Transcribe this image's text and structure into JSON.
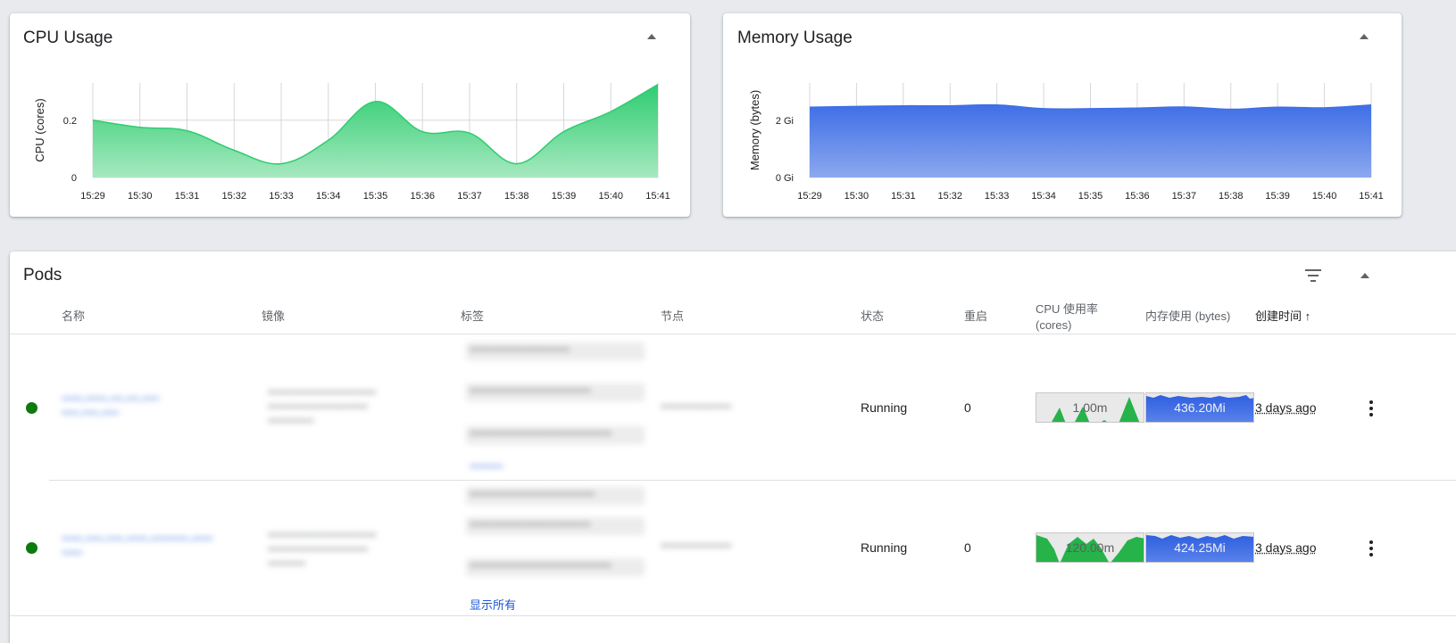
{
  "cpu_panel": {
    "title": "CPU Usage",
    "chart_data": {
      "type": "area",
      "title": "",
      "xlabel": "",
      "ylabel": "CPU (cores)",
      "x": [
        "15:29",
        "15:30",
        "15:31",
        "15:32",
        "15:33",
        "15:34",
        "15:35",
        "15:36",
        "15:37",
        "15:38",
        "15:39",
        "15:40",
        "15:41"
      ],
      "y_ticks": [
        "0",
        "0.2"
      ],
      "ylim": [
        0,
        0.33
      ],
      "series": [
        {
          "values": [
            0.2,
            0.175,
            0.163,
            0.095,
            0.048,
            0.13,
            0.265,
            0.16,
            0.155,
            0.048,
            0.16,
            0.23,
            0.325
          ],
          "color": "#2ecc71"
        }
      ],
      "grid": true
    }
  },
  "memory_panel": {
    "title": "Memory Usage",
    "chart_data": {
      "type": "area",
      "title": "",
      "xlabel": "",
      "ylabel": "Memory (bytes)",
      "x": [
        "15:29",
        "15:30",
        "15:31",
        "15:32",
        "15:33",
        "15:34",
        "15:35",
        "15:36",
        "15:37",
        "15:38",
        "15:39",
        "15:40",
        "15:41"
      ],
      "y_ticks": [
        "0 Gi",
        "2 Gi"
      ],
      "ylim": [
        0,
        3.3
      ],
      "series": [
        {
          "values": [
            2.45,
            2.48,
            2.5,
            2.5,
            2.53,
            2.4,
            2.4,
            2.42,
            2.46,
            2.38,
            2.45,
            2.43,
            2.53
          ],
          "color": "#3f6fe6"
        }
      ],
      "grid": true
    }
  },
  "pods_panel": {
    "title": "Pods",
    "columns": {
      "name": "名称",
      "image": "镜像",
      "labels": "标签",
      "node": "节点",
      "status": "状态",
      "restarts": "重启",
      "cpu": "CPU 使用率",
      "cpu_unit": "(cores)",
      "memory": "内存使用 (bytes)",
      "created": "创建时间 ↑"
    },
    "rows": [
      {
        "status": "Running",
        "restarts": "0",
        "cpu_usage": "1.00m",
        "memory_usage": "436.20Mi",
        "created": "3 days ago",
        "status_color": "#0d7a0d"
      },
      {
        "status": "Running",
        "restarts": "0",
        "cpu_usage": "120.00m",
        "memory_usage": "424.25Mi",
        "created": "3 days ago",
        "show_all": "显示所有",
        "status_color": "#0d7a0d"
      }
    ]
  },
  "colors": {
    "cpu_green": "#2ecc71",
    "memory_blue": "#3f6fe6",
    "link_blue": "#1a56db",
    "running_green": "#0d7a0d"
  }
}
